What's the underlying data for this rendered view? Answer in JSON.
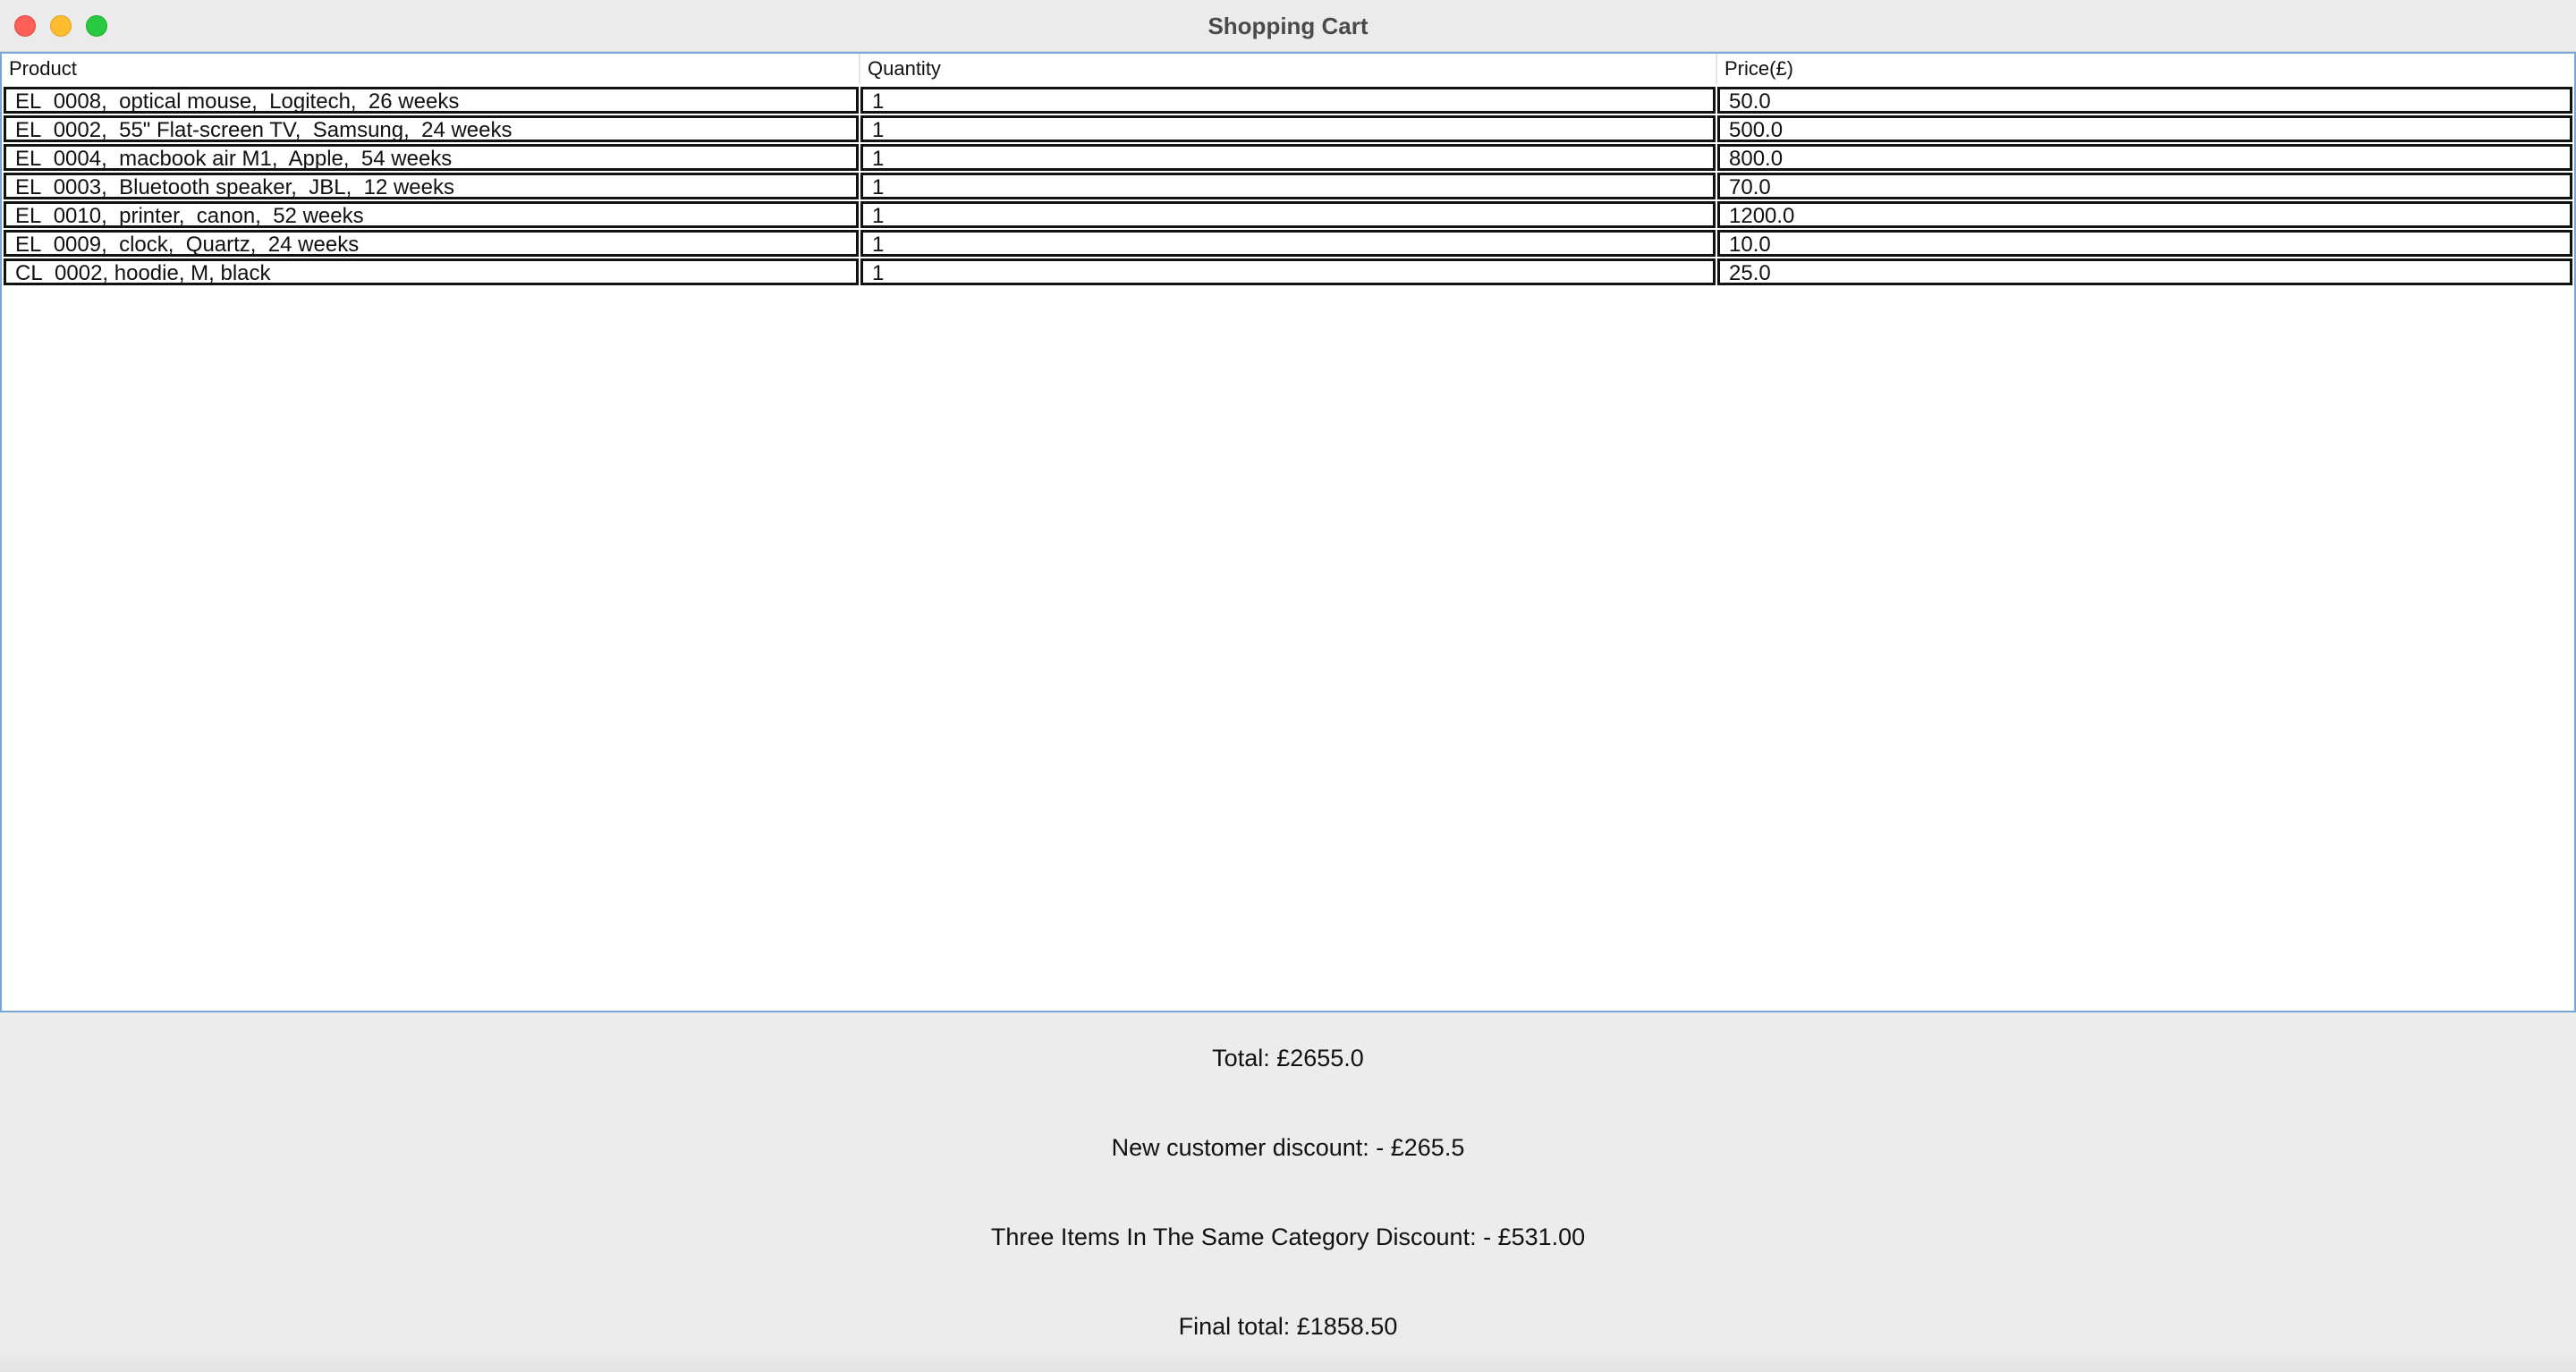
{
  "window": {
    "title": "Shopping Cart"
  },
  "table": {
    "columns": [
      "Product",
      "Quantity",
      "Price(£)"
    ],
    "rows": [
      [
        "EL_0008,  optical mouse,  Logitech,  26 weeks",
        "1",
        "50.0"
      ],
      [
        "EL_0002,  55\" Flat-screen TV,  Samsung,  24 weeks",
        "1",
        "500.0"
      ],
      [
        "EL_0004,  macbook air M1,  Apple,  54 weeks",
        "1",
        "800.0"
      ],
      [
        "EL_0003,  Bluetooth speaker,  JBL,  12 weeks",
        "1",
        "70.0"
      ],
      [
        "EL_0010,  printer,  canon,  52 weeks",
        "1",
        "1200.0"
      ],
      [
        "EL_0009,  clock,  Quartz,  24 weeks",
        "1",
        "10.0"
      ],
      [
        "CL_0002, hoodie, M, black",
        "1",
        "25.0"
      ]
    ]
  },
  "summary": {
    "total": "Total: £2655.0",
    "new_customer_discount": "New customer discount: - £265.5",
    "category_discount": "Three Items In The Same Category Discount: - £531.00",
    "final_total": "Final total: £1858.50"
  },
  "colors": {
    "close": "#fe5f57",
    "minimize": "#febc2e",
    "maximize": "#28c840",
    "focus_border": "#79a6d8"
  }
}
